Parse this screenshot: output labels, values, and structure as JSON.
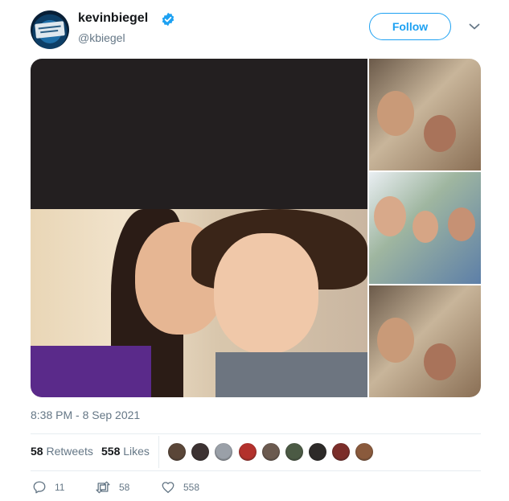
{
  "user": {
    "name": "kevinbiegel",
    "handle": "@kbiegel",
    "verified": true,
    "avatar_icon": "avatar-sign-icon"
  },
  "follow_label": "Follow",
  "timestamp": "8:38 PM - 8 Sep 2021",
  "stats": {
    "retweets_count": "58",
    "retweets_label": "Retweets",
    "likes_count": "558",
    "likes_label": "Likes"
  },
  "likers": [
    {
      "color": "#5a4638"
    },
    {
      "color": "#3c3232"
    },
    {
      "color": "#9aa0a8"
    },
    {
      "color": "#b3312c"
    },
    {
      "color": "#6b5a4f"
    },
    {
      "color": "#4b5a44"
    },
    {
      "color": "#2d2a28"
    },
    {
      "color": "#7b2e2a"
    },
    {
      "color": "#8a5a3c"
    }
  ],
  "actions": {
    "replies": "11",
    "retweets": "58",
    "likes": "558"
  },
  "colors": {
    "accent": "#1da1f2",
    "muted": "#657786",
    "text": "#14171a"
  }
}
